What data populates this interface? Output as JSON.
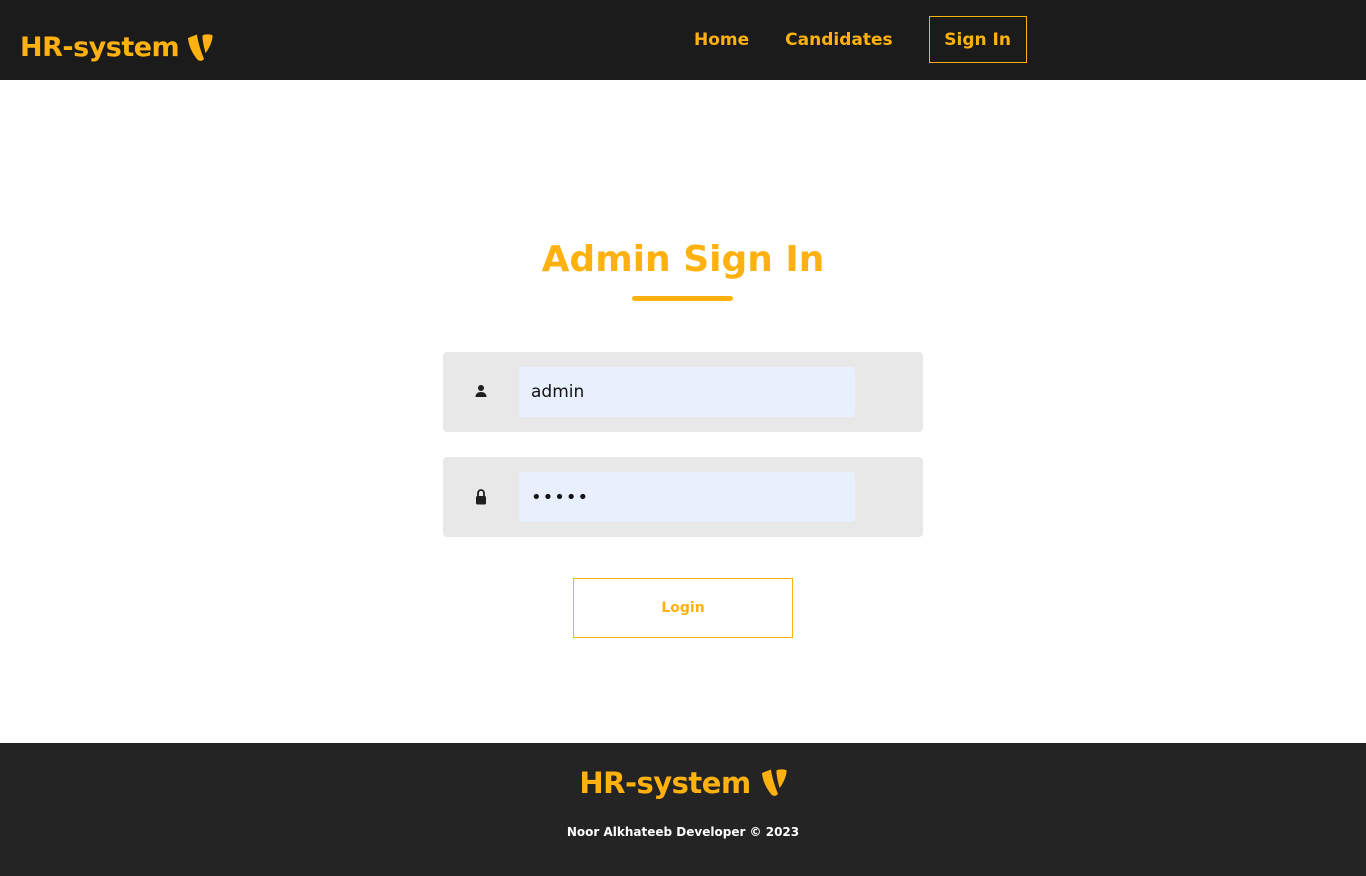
{
  "header": {
    "brand": "HR-system",
    "nav": {
      "home": "Home",
      "candidates": "Candidates",
      "sign_in": "Sign In"
    }
  },
  "login_form": {
    "title": "Admin Sign In",
    "username": {
      "value": "admin",
      "icon": "user-icon"
    },
    "password": {
      "value": "•••••",
      "icon": "lock-icon"
    },
    "submit_label": "Login"
  },
  "footer": {
    "brand": "HR-system",
    "copyright": "Noor Alkhateeb Developer © 2023"
  },
  "colors": {
    "accent": "#ffb20f",
    "navbar_bg": "#1c1b1b",
    "footer_bg": "#242424",
    "field_bg": "#e8e8e8",
    "input_bg": "#e8f0fe"
  },
  "icons": {
    "brand_logo": "typo3-logo-icon"
  }
}
